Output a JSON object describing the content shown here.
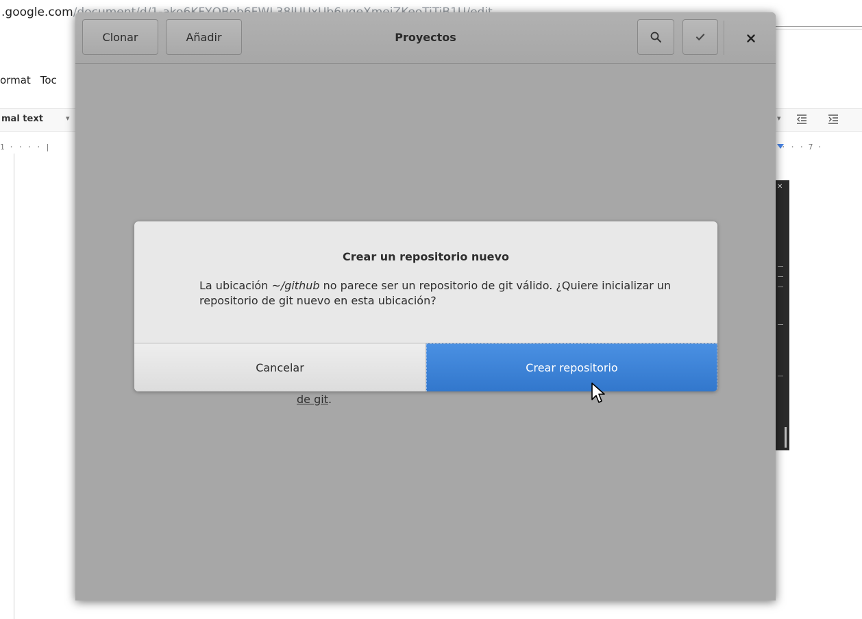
{
  "browser": {
    "url_host": ".google.com",
    "url_path": "/document/d/1-ako6KFYQBob6FWL38lUUxUb6ugeXmeiZKeoTiTiB1U/edit",
    "menu": [
      "ormat",
      "Toc"
    ],
    "style_select": "mal text",
    "ruler_left": "1 · · · · |",
    "ruler_right": "· · · 7 ·"
  },
  "window": {
    "title": "Proyectos",
    "clone_label": "Clonar",
    "add_label": "Añadir",
    "search_icon": "search-icon",
    "confirm_icon": "checkmark-icon",
    "close_icon": "close-icon"
  },
  "dialog": {
    "title": "Crear un repositorio nuevo",
    "body_prefix": "La ubicación ",
    "body_path": "~/github",
    "body_suffix": " no parece ser un repositorio de git válido. ¿Quiere inicializar un repositorio de git nuevo en esta ubicación?",
    "cancel_label": "Cancelar",
    "create_label": "Crear repositorio"
  },
  "background_text": {
    "link": "de git",
    "punct": "."
  },
  "colors": {
    "accent": "#3b82d6",
    "window_bg": "#a7a7a7",
    "dialog_bg": "#e8e8e8"
  }
}
